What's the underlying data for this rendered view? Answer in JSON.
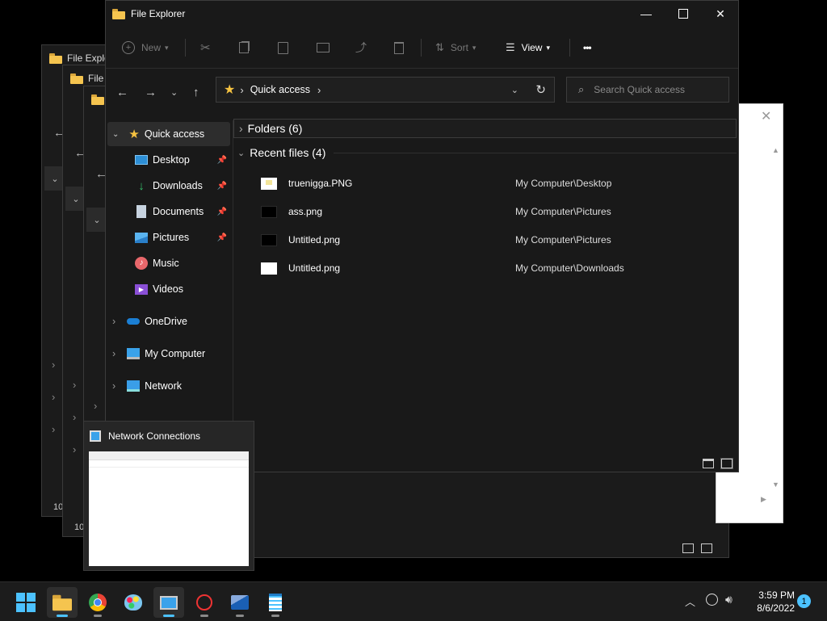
{
  "background_windows": {
    "title_1": "File Explorer",
    "title_2": "File Explorer",
    "status_1": "10",
    "status_2": "10"
  },
  "explorer": {
    "title": "File Explorer",
    "toolbar": {
      "new_label": "New",
      "sort_label": "Sort",
      "view_label": "View",
      "more_label": "•••"
    },
    "address": {
      "location": "Quick access"
    },
    "search": {
      "placeholder": "Search Quick access"
    },
    "sidebar": {
      "quick_access": "Quick access",
      "pinned": [
        {
          "label": "Desktop",
          "icon": "desktop-icon"
        },
        {
          "label": "Downloads",
          "icon": "downloads-icon"
        },
        {
          "label": "Documents",
          "icon": "documents-icon"
        },
        {
          "label": "Pictures",
          "icon": "pictures-icon"
        }
      ],
      "music": "Music",
      "videos": "Videos",
      "onedrive": "OneDrive",
      "my_computer": "My Computer",
      "network": "Network"
    },
    "groups": {
      "folders": "Folders (6)",
      "recent": "Recent files (4)"
    },
    "recent_files": [
      {
        "name": "truenigga.PNG",
        "location": "My Computer\\Desktop"
      },
      {
        "name": "ass.png",
        "location": "My Computer\\Pictures"
      },
      {
        "name": "Untitled.png",
        "location": "My Computer\\Pictures"
      },
      {
        "name": "Untitled.png",
        "location": "My Computer\\Downloads"
      }
    ]
  },
  "preview": {
    "title": "Network Connections"
  },
  "taskbar": {
    "apps": [
      "start-icon",
      "file-explorer-icon",
      "chrome-icon",
      "paint-icon",
      "network-connections-icon",
      "paint-brush-icon",
      "photos-icon",
      "notepad-icon"
    ],
    "time": "3:59 PM",
    "date": "8/6/2022",
    "notification_count": "1"
  },
  "colors": {
    "accent": "#4cc2ff",
    "folder": "#f5c44f",
    "star": "#f6c341"
  }
}
